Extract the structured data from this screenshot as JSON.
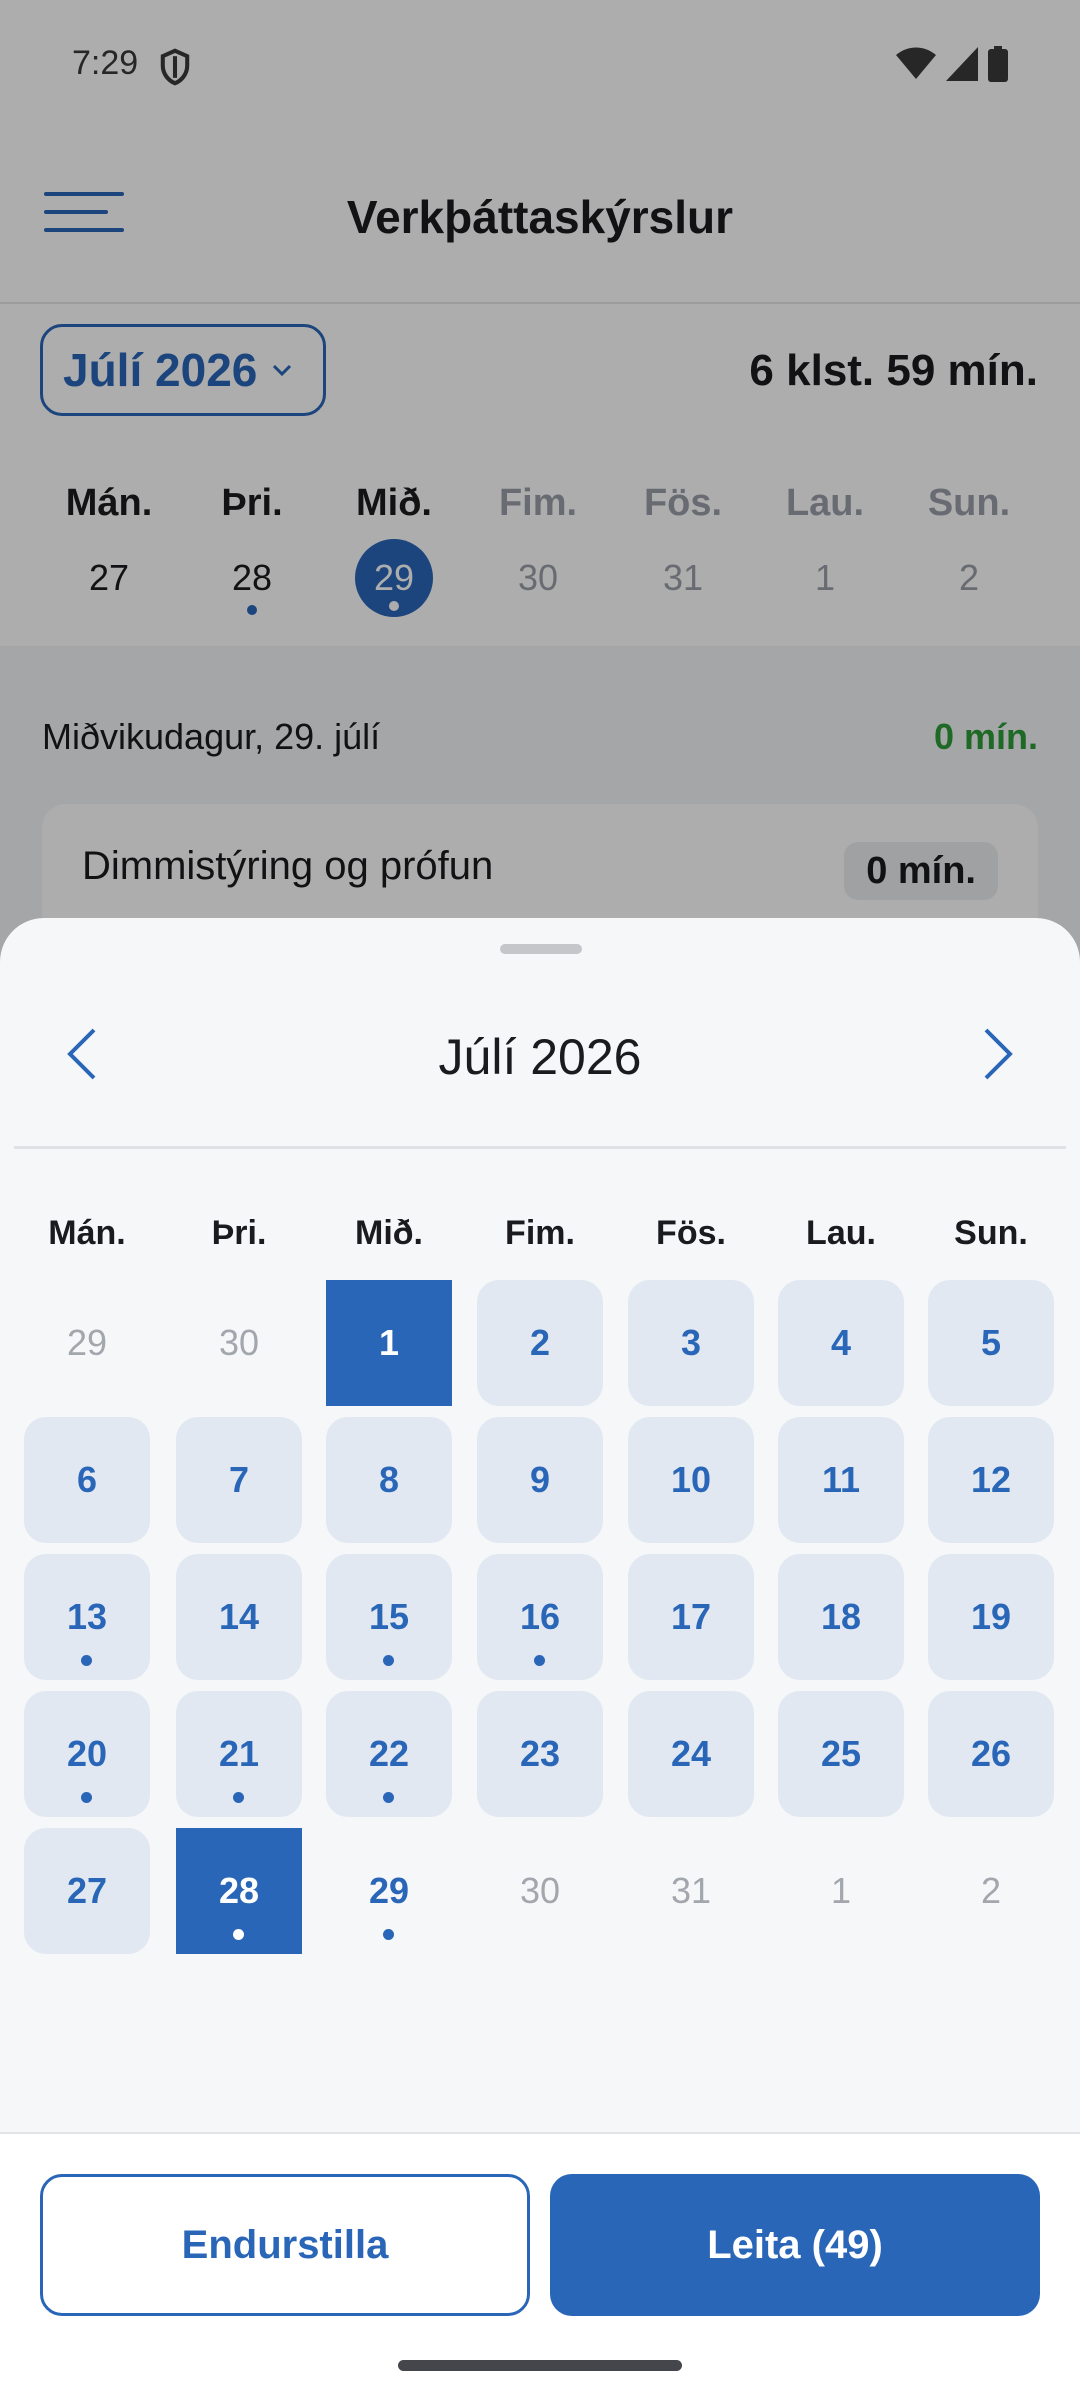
{
  "status": {
    "time": "7:29"
  },
  "appbar": {
    "title": "Verkþáttaskýrslur"
  },
  "filter": {
    "month_label": "Júlí 2026",
    "total_time": "6 klst. 59 mín."
  },
  "week": [
    {
      "name": "Mán.",
      "num": "27",
      "state": "normal",
      "dot": false
    },
    {
      "name": "Þri.",
      "num": "28",
      "state": "normal",
      "dot": true
    },
    {
      "name": "Mið.",
      "num": "29",
      "state": "selected",
      "dot": true
    },
    {
      "name": "Fim.",
      "num": "30",
      "state": "dim",
      "dot": false
    },
    {
      "name": "Fös.",
      "num": "31",
      "state": "dim",
      "dot": false
    },
    {
      "name": "Lau.",
      "num": "1",
      "state": "dim",
      "dot": false
    },
    {
      "name": "Sun.",
      "num": "2",
      "state": "dim",
      "dot": false
    }
  ],
  "day": {
    "title": "Miðvikudagur, 29. júlí",
    "total": "0 mín."
  },
  "task": {
    "name": "Dimmistýring og prófun",
    "duration": "0 mín."
  },
  "sheet": {
    "month_title": "Júlí 2026",
    "weekday_headers": [
      "Mán.",
      "Þri.",
      "Mið.",
      "Fim.",
      "Fös.",
      "Lau.",
      "Sun."
    ],
    "days": [
      {
        "label": "29",
        "kind": "out",
        "dot": false
      },
      {
        "label": "30",
        "kind": "out",
        "dot": false
      },
      {
        "label": "1",
        "kind": "sel",
        "dot": false
      },
      {
        "label": "2",
        "kind": "in",
        "dot": false
      },
      {
        "label": "3",
        "kind": "in",
        "dot": false
      },
      {
        "label": "4",
        "kind": "in",
        "dot": false
      },
      {
        "label": "5",
        "kind": "in",
        "dot": false
      },
      {
        "label": "6",
        "kind": "in",
        "dot": false
      },
      {
        "label": "7",
        "kind": "in",
        "dot": false
      },
      {
        "label": "8",
        "kind": "in",
        "dot": false
      },
      {
        "label": "9",
        "kind": "in",
        "dot": false
      },
      {
        "label": "10",
        "kind": "in",
        "dot": false
      },
      {
        "label": "11",
        "kind": "in",
        "dot": false
      },
      {
        "label": "12",
        "kind": "in",
        "dot": false
      },
      {
        "label": "13",
        "kind": "in",
        "dot": true
      },
      {
        "label": "14",
        "kind": "in",
        "dot": false
      },
      {
        "label": "15",
        "kind": "in",
        "dot": true
      },
      {
        "label": "16",
        "kind": "in",
        "dot": true
      },
      {
        "label": "17",
        "kind": "in",
        "dot": false
      },
      {
        "label": "18",
        "kind": "in",
        "dot": false
      },
      {
        "label": "19",
        "kind": "in",
        "dot": false
      },
      {
        "label": "20",
        "kind": "in",
        "dot": true
      },
      {
        "label": "21",
        "kind": "in",
        "dot": true
      },
      {
        "label": "22",
        "kind": "in",
        "dot": true
      },
      {
        "label": "23",
        "kind": "in",
        "dot": false
      },
      {
        "label": "24",
        "kind": "in",
        "dot": false
      },
      {
        "label": "25",
        "kind": "in",
        "dot": false
      },
      {
        "label": "26",
        "kind": "in",
        "dot": false
      },
      {
        "label": "27",
        "kind": "in",
        "dot": false
      },
      {
        "label": "28",
        "kind": "sel",
        "dot": true
      },
      {
        "label": "29",
        "kind": "plain",
        "dot": true
      },
      {
        "label": "30",
        "kind": "out",
        "dot": false
      },
      {
        "label": "31",
        "kind": "out",
        "dot": false
      },
      {
        "label": "1",
        "kind": "out",
        "dot": false
      },
      {
        "label": "2",
        "kind": "out",
        "dot": false
      }
    ]
  },
  "buttons": {
    "reset": "Endurstilla",
    "search": "Leita (49)"
  },
  "colors": {
    "primary": "#2a66b8",
    "success": "#2e9b3a",
    "cell_bg": "#e1e8f1"
  }
}
